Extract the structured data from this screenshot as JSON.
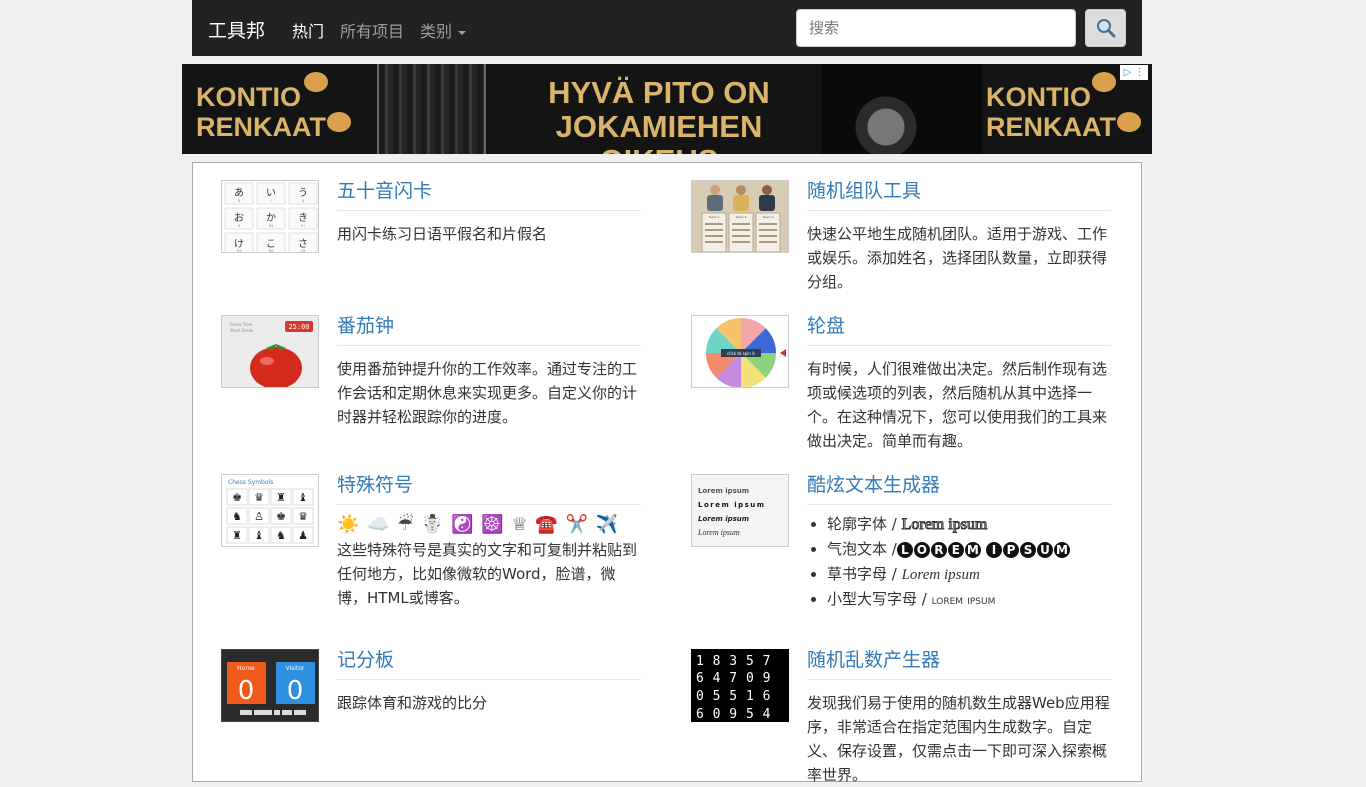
{
  "navbar": {
    "brand": "工具邦",
    "links": [
      "热门",
      "所有项目",
      "类别"
    ],
    "search_placeholder": "搜索",
    "search_icon": "magnifier-icon"
  },
  "ad": {
    "brand_left": [
      "KONTIO",
      "RENKAAT"
    ],
    "headline": [
      "HYVÄ PITO ON",
      "JOKAMIEHEN OIKEUS"
    ],
    "brand_right": [
      "KONTIO",
      "RENKAAT"
    ]
  },
  "thumbs": {
    "kana": [
      "あ",
      "い",
      "う",
      "お",
      "か",
      "き",
      "け",
      "こ",
      "さ"
    ],
    "kana_romaji": [
      "a",
      "i",
      "u",
      "o",
      "ka",
      "ki",
      "ke",
      "ko",
      "sa"
    ],
    "symbols_title": "Chess Symbols",
    "symbols": [
      "♚",
      "♛",
      "♜",
      "♝",
      "♞",
      "♙",
      "♚",
      "♛",
      "♜",
      "♝",
      "♞",
      "♟"
    ],
    "timer": {
      "value": "25:00",
      "labels": [
        "Focus Time",
        "Short Break"
      ]
    },
    "wheel_label": "click to spin it",
    "lorem": [
      "Lorem ipsum",
      "Lorem ipsum",
      "Lorem ipsum",
      "Lorem ipsum"
    ],
    "scoreboard": {
      "home_label": "Home",
      "visitor_label": "Visitor",
      "home": "0",
      "visitor": "0"
    },
    "digits": [
      "1 8 3 5 7",
      "6 4 7 0 9",
      "0 5 5 1 6",
      "6 0 9 5 4"
    ],
    "teams": [
      "Team 1",
      "Team 2",
      "Team 3"
    ]
  },
  "items": [
    {
      "title": "五十音闪卡",
      "desc": "用闪卡练习日语平假名和片假名"
    },
    {
      "title": "随机组队工具",
      "desc": "快速公平地生成随机团队。适用于游戏、工作或娱乐。添加姓名，选择团队数量，立即获得分组。"
    },
    {
      "title": "番茄钟",
      "desc": "使用番茄钟提升你的工作效率。通过专注的工作会话和定期休息来实现更多。自定义你的计时器并轻松跟踪你的进度。"
    },
    {
      "title": "轮盘",
      "desc": "有时候，人们很难做出决定。然后制作现有选项或候选项的列表，然后随机从其中选择一个。在这种情况下，您可以使用我们的工具来做出决定。简单而有趣。"
    },
    {
      "title": "特殊符号",
      "symbols": "☀️ ☁️ ☔ ☃️ ☯️ ☸️ ♕ ☎️ ✂️ ✈️",
      "desc": "这些特殊符号是真实的文字和可复制并粘贴到任何地方，比如像微软的Word，脸谱，微博，HTML或博客。"
    },
    {
      "title": "酷炫文本生成器",
      "list": [
        {
          "label": "轮廓字体 / ",
          "sample": "Lorem ipsum"
        },
        {
          "label": "气泡文本 /",
          "sample": "LOREM IPSUM"
        },
        {
          "label": "草书字母 / ",
          "sample": "Lorem ipsum"
        },
        {
          "label": "小型大写字母 / ",
          "sample": "lorem ipsum"
        }
      ]
    },
    {
      "title": "记分板",
      "desc": "跟踪体育和游戏的比分"
    },
    {
      "title": "随机乱数产生器",
      "desc": "发现我们易于使用的随机数生成器Web应用程序，非常适合在指定范围内生成数字。自定义、保存设置，仅需点击一下即可深入探索概率世界。"
    }
  ]
}
